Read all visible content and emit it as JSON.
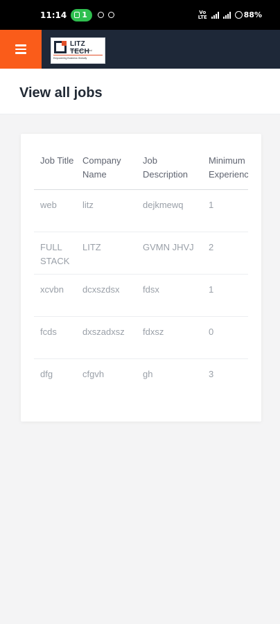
{
  "status_bar": {
    "time": "11:14",
    "call_pill": "1",
    "battery": "88%"
  },
  "app_bar": {
    "menu_icon": "hamburger-menu-icon",
    "logo": {
      "name": "LITZ TECH",
      "tagline": "India Private Limited",
      "subline": "Empowering Business Globally"
    },
    "colors": {
      "bar": "#1e2838",
      "accent": "#fa5c1a"
    }
  },
  "page": {
    "title": "View all jobs"
  },
  "jobs_table": {
    "headers": {
      "job_title": "Job Title",
      "company_name": "Company Name",
      "job_description": "Job Description",
      "minimum_experience": "Minimum Experience"
    },
    "rows": [
      {
        "job_title": "web",
        "company_name": "litz",
        "job_description": "dejkmewq",
        "minimum_experience": "1"
      },
      {
        "job_title": "FULL STACK",
        "company_name": "LITZ",
        "job_description": "GVMN JHVJ",
        "minimum_experience": "2"
      },
      {
        "job_title": "xcvbn",
        "company_name": "dcxszdsx",
        "job_description": "fdsx",
        "minimum_experience": "1"
      },
      {
        "job_title": "fcds",
        "company_name": "dxszadxsz",
        "job_description": "fdxsz",
        "minimum_experience": "0"
      },
      {
        "job_title": "dfg",
        "company_name": "cfgvh",
        "job_description": "gh",
        "minimum_experience": "3"
      }
    ]
  }
}
